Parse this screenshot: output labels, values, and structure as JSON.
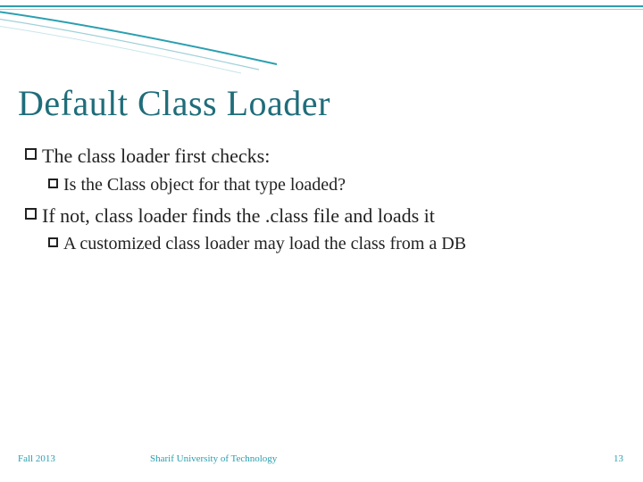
{
  "title": "Default Class Loader",
  "bullets": {
    "b1": "The class loader first checks:",
    "b1a": "Is the Class object for that type loaded?",
    "b2": "If not, class loader finds the .class file and loads it",
    "b2a": "A customized class loader may load the class from a DB"
  },
  "footer": {
    "date": "Fall 2013",
    "org": "Sharif University of Technology",
    "page": "13"
  },
  "colors": {
    "accent": "#2a9fb0",
    "title": "#1f6d7a"
  }
}
